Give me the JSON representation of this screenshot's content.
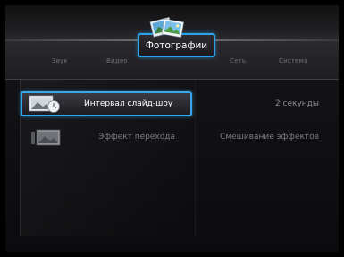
{
  "tabs": [
    {
      "label": "Звук"
    },
    {
      "label": "Видео"
    },
    {
      "label": "Фотографии"
    },
    {
      "label": "Сеть"
    },
    {
      "label": "Система"
    }
  ],
  "settings": [
    {
      "label": "Интервал слайд-шоу",
      "value": "2 секунды"
    },
    {
      "label": "Эффект перехода",
      "value": "Смешивание эффектов"
    }
  ],
  "colors": {
    "accent": "#2fa1e6",
    "inactive_text": "#6f6f78",
    "background": "#0d0d0f"
  }
}
